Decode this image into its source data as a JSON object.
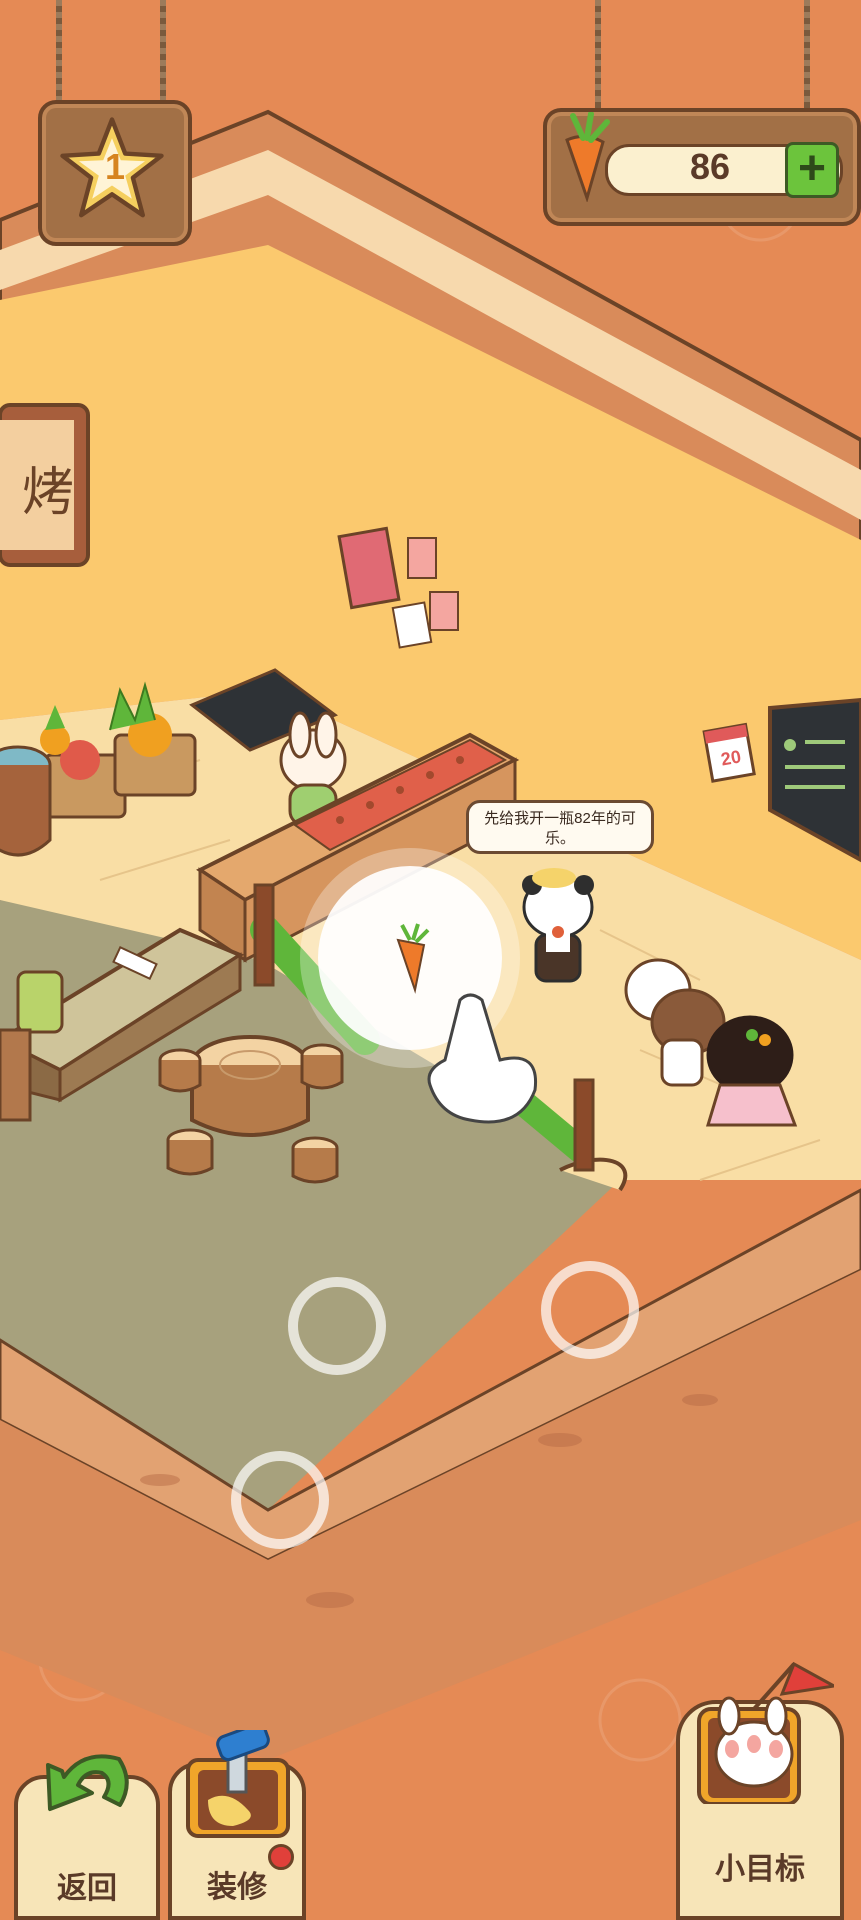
{
  "hud": {
    "level_value": "1",
    "carrot_count": "86",
    "add_symbol": "+"
  },
  "speech": {
    "text": "先给我开一瓶82年的可乐。"
  },
  "calendar": {
    "day": "20"
  },
  "bottom_bar": {
    "back_label": "返回",
    "decorate_label": "装修",
    "goals_label": "小目标"
  },
  "colors": {
    "background": "#e58a55",
    "wall": "#fbc96e",
    "floor_wood": "#f9dea5",
    "floor_grass": "#a7a17d",
    "accent_green": "#5fb63a"
  },
  "icons": [
    "star-icon",
    "carrot-icon",
    "plus-icon",
    "back-arrow-icon",
    "paint-bucket-icon",
    "flag-icon",
    "bunny-paw-icon",
    "tap-hand-icon"
  ]
}
